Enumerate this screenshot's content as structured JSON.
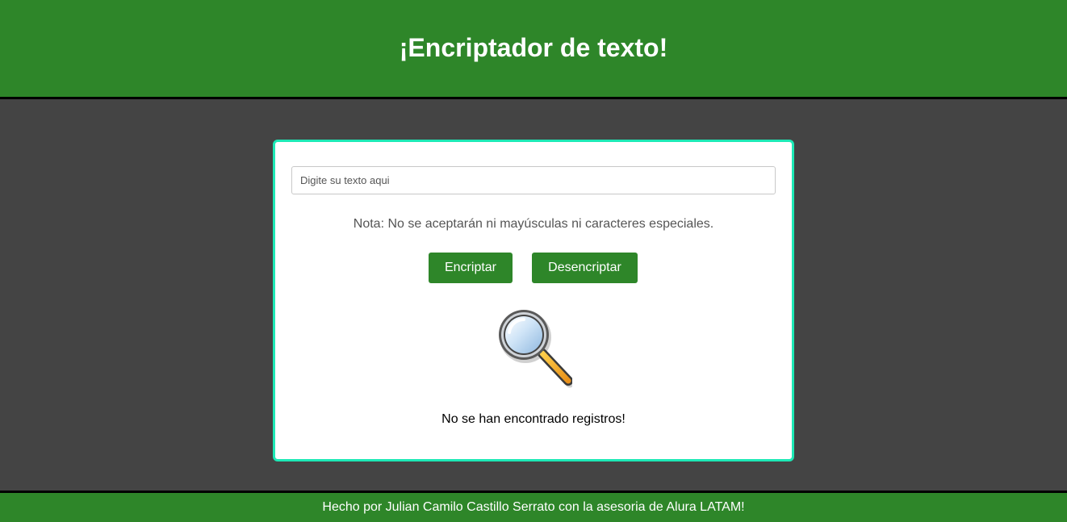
{
  "header": {
    "title": "¡Encriptador de texto!"
  },
  "main": {
    "input_placeholder": "Digite su texto aqui",
    "input_value": "",
    "note": "Nota: No se aceptarán ni mayúsculas ni caracteres especiales.",
    "encrypt_label": "Encriptar",
    "decrypt_label": "Desencriptar",
    "illustration_icon": "magnifying-glass-icon",
    "empty_message": "No se han encontrado registros!"
  },
  "footer": {
    "text": "Hecho por Julian Camilo Castillo Serrato con la asesoria de Alura LATAM!"
  },
  "colors": {
    "primary_green": "#2e8629",
    "background": "#444444",
    "card_border": "#1de9b6"
  }
}
